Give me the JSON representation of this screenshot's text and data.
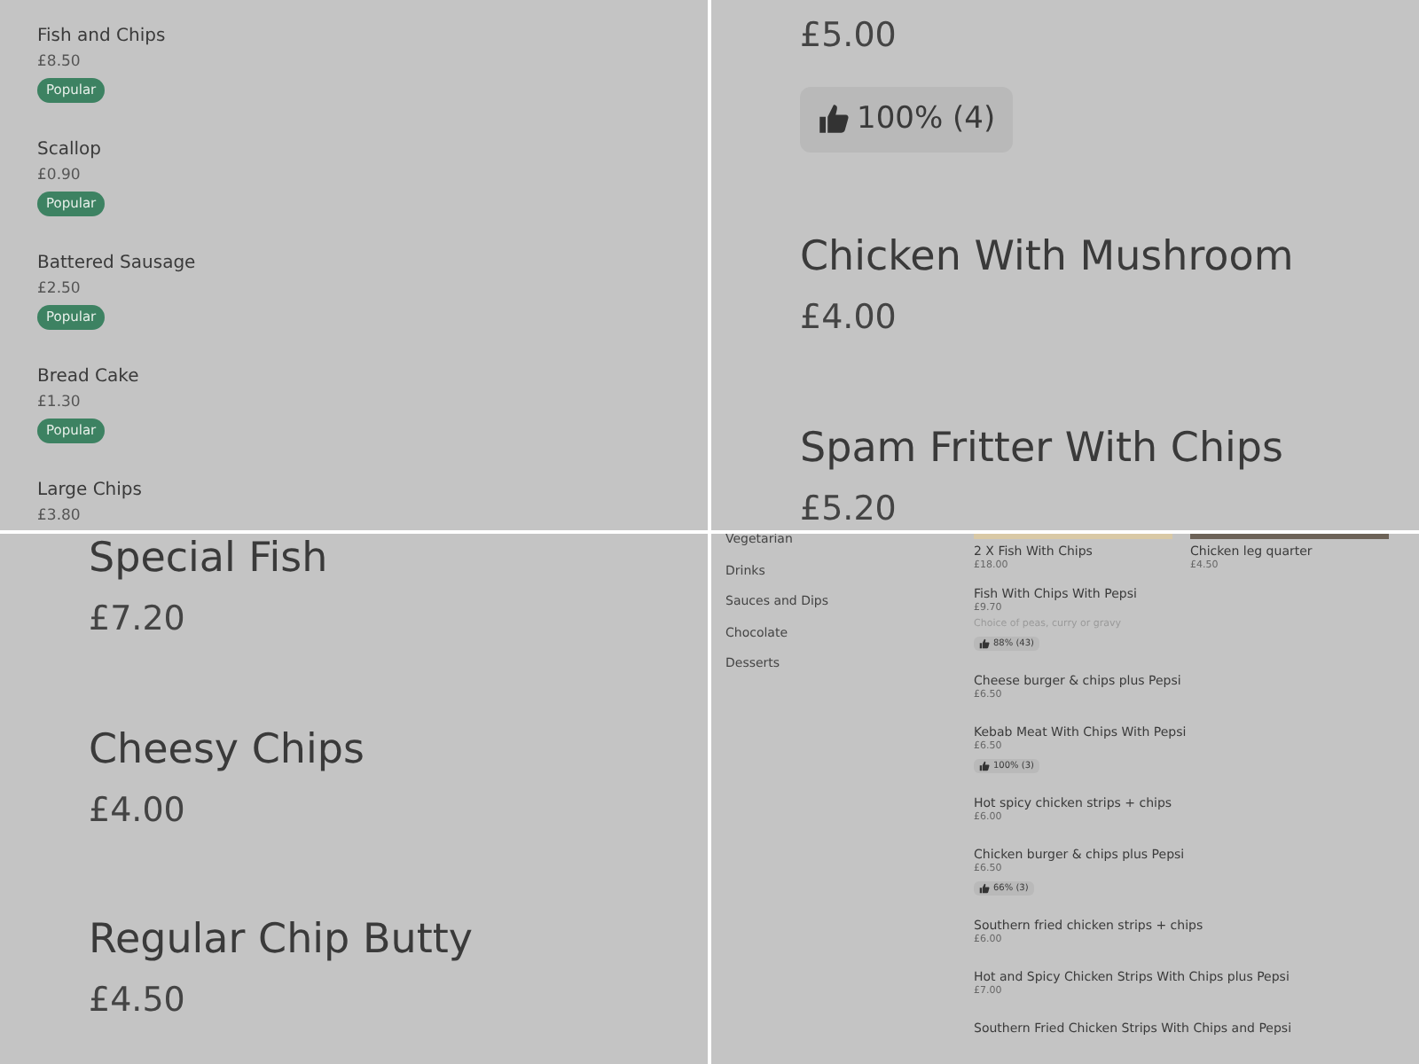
{
  "panels": [
    {
      "kind": "list",
      "items": [
        {
          "name": "Fish and Chips",
          "price": "£8.50",
          "badge": "Popular"
        },
        {
          "name": "Scallop",
          "price": "£0.90",
          "badge": "Popular"
        },
        {
          "name": "Battered Sausage",
          "price": "£2.50",
          "badge": "Popular"
        },
        {
          "name": "Bread Cake",
          "price": "£1.30",
          "badge": "Popular"
        },
        {
          "name": "Large Chips",
          "price": "£3.80"
        }
      ]
    },
    {
      "kind": "zoom",
      "items": [
        {
          "price": "£5.00",
          "rating": "100% (4)"
        },
        {
          "name": "Chicken With Mushroom",
          "price": "£4.00"
        },
        {
          "name": "Spam Fritter With Chips",
          "price": "£5.20"
        }
      ]
    },
    {
      "kind": "zoom",
      "items": [
        {
          "name": "Special Fish",
          "price": "£7.20"
        },
        {
          "name": "Cheesy Chips",
          "price": "£4.00"
        },
        {
          "name": "Regular Chip Butty",
          "price": "£4.50"
        }
      ]
    },
    {
      "kind": "menu",
      "categories": [
        "Vegetarian",
        "Drinks",
        "Sauces and Dips",
        "Chocolate",
        "Desserts"
      ],
      "featured": [
        {
          "name": "2 X Fish With Chips",
          "price": "£18.00"
        },
        {
          "name": "Chicken leg quarter",
          "price": "£4.50"
        }
      ],
      "items": [
        {
          "name": "Fish With Chips With Pepsi",
          "price": "£9.70",
          "description": "Choice of peas, curry or gravy",
          "rating": "88% (43)"
        },
        {
          "name": "Cheese burger & chips plus Pepsi",
          "price": "£6.50"
        },
        {
          "name": "Kebab Meat With Chips With Pepsi",
          "price": "£6.50",
          "rating": "100% (3)"
        },
        {
          "name": "Hot spicy chicken strips + chips",
          "price": "£6.00"
        },
        {
          "name": "Chicken burger & chips plus Pepsi",
          "price": "£6.50",
          "rating": "66% (3)"
        },
        {
          "name": "Southern fried chicken strips + chips",
          "price": "£6.00"
        },
        {
          "name": "Hot and Spicy Chicken Strips With Chips plus Pepsi",
          "price": "£7.00"
        },
        {
          "name": "Southern Fried Chicken Strips With Chips and Pepsi"
        }
      ]
    }
  ]
}
